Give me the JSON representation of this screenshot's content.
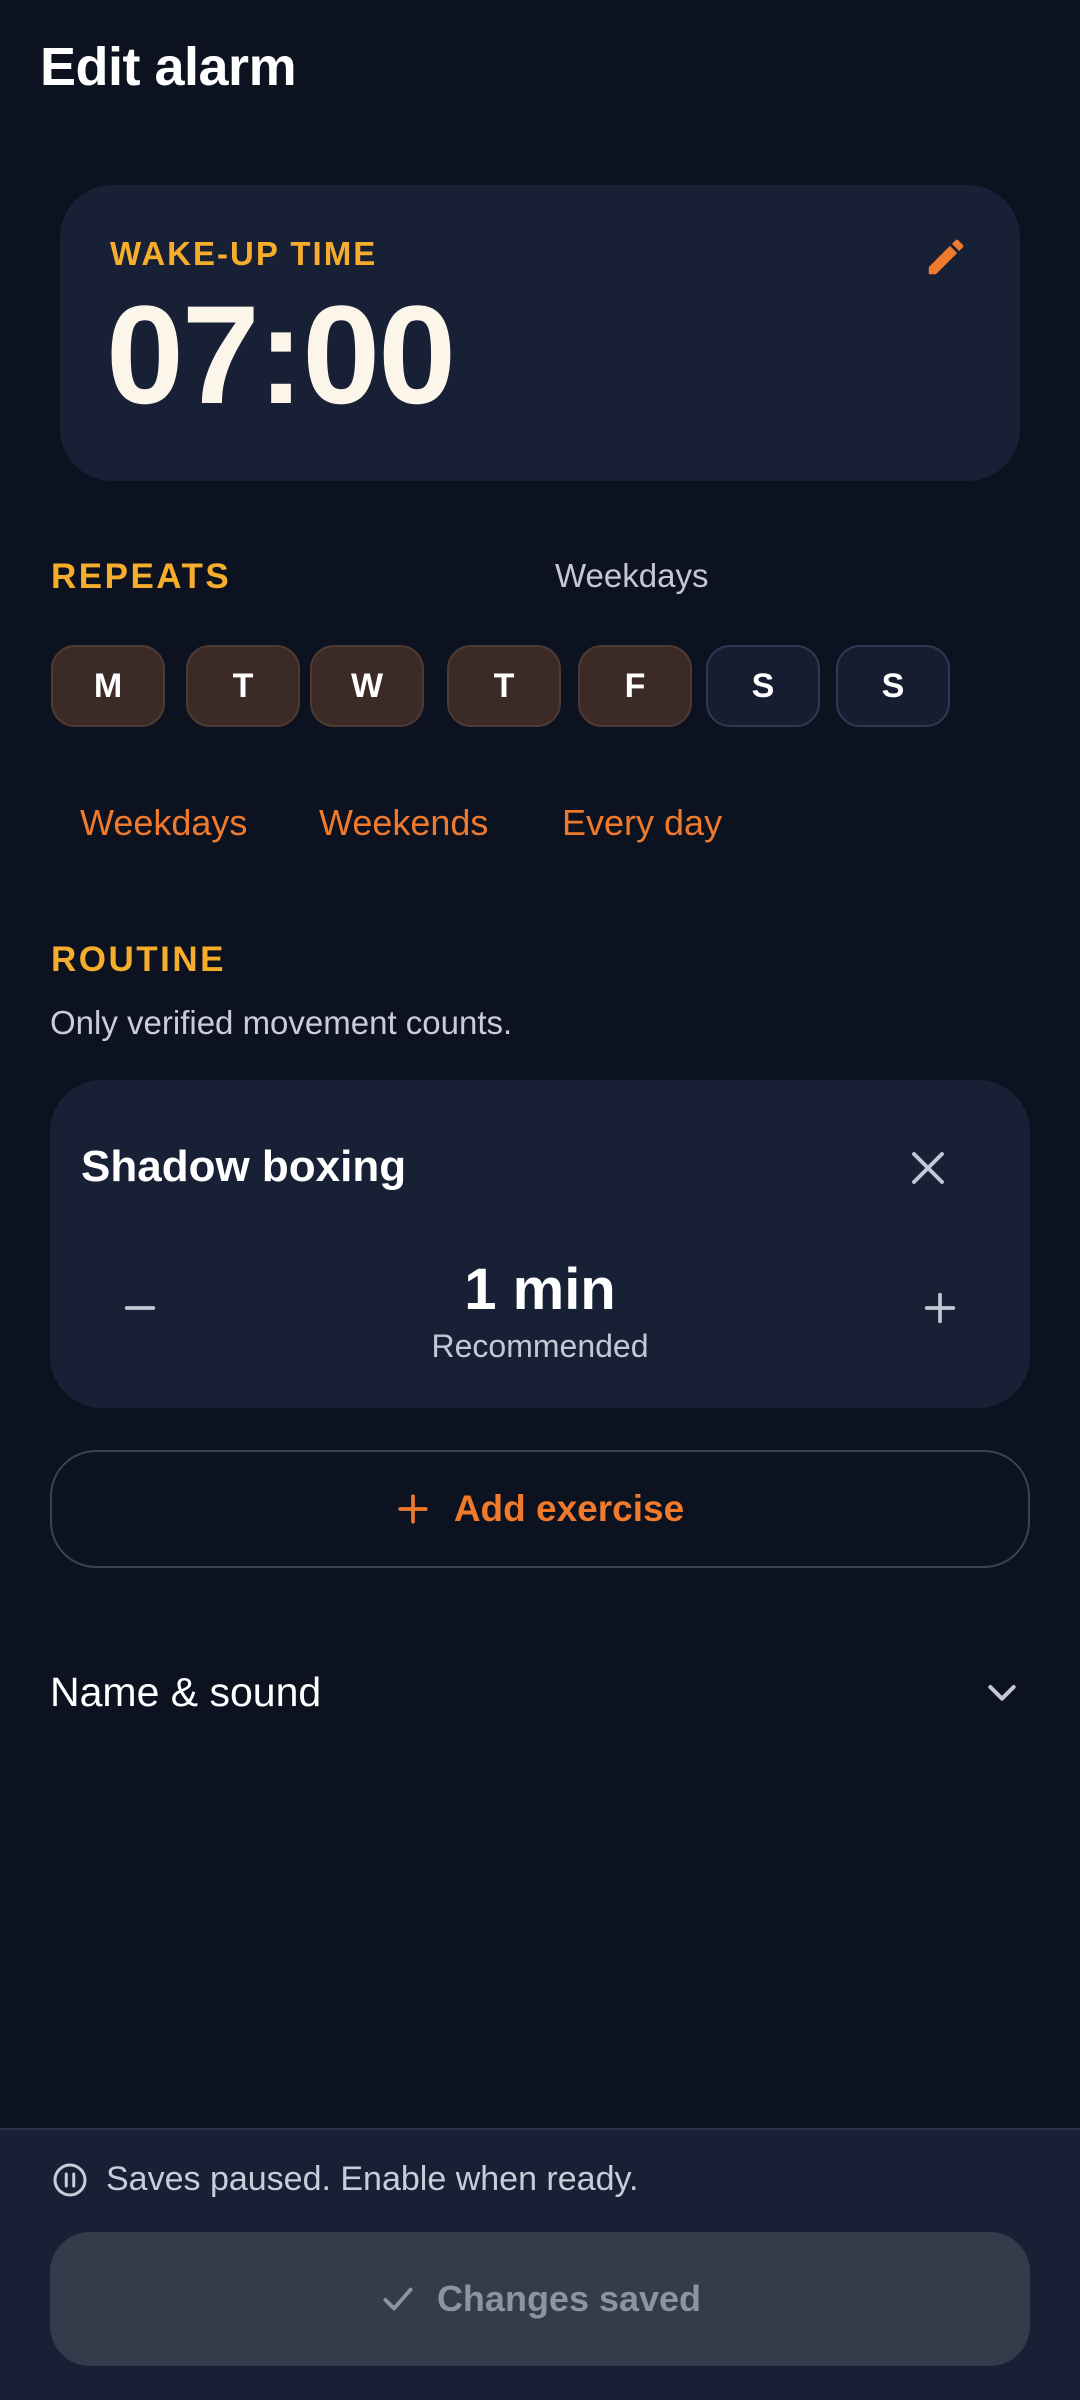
{
  "header": {
    "title": "Edit alarm"
  },
  "wake": {
    "label": "WAKE-UP TIME",
    "time": "07:00",
    "edit_icon": "pencil-icon"
  },
  "repeats": {
    "label": "REPEATS",
    "summary": "Weekdays",
    "days": [
      {
        "letter": "M",
        "selected": true
      },
      {
        "letter": "T",
        "selected": true
      },
      {
        "letter": "W",
        "selected": true
      },
      {
        "letter": "T",
        "selected": true
      },
      {
        "letter": "F",
        "selected": true
      },
      {
        "letter": "S",
        "selected": false
      },
      {
        "letter": "S",
        "selected": false
      }
    ],
    "presets": [
      "Weekdays",
      "Weekends",
      "Every day"
    ]
  },
  "routine": {
    "label": "ROUTINE",
    "subtitle": "Only verified movement counts.",
    "exercise": {
      "name": "Shadow boxing",
      "duration": "1 min",
      "note": "Recommended",
      "remove_icon": "close-icon",
      "decrease_icon": "minus-icon",
      "increase_icon": "plus-icon"
    },
    "add_label": "Add exercise"
  },
  "name_sound": {
    "label": "Name & sound",
    "icon": "chevron-down-icon"
  },
  "footer": {
    "status": "Saves paused. Enable when ready.",
    "status_icon": "pause-circle-icon",
    "save_label": "Changes saved",
    "save_icon": "check-icon"
  },
  "colors": {
    "background": "#0d1220",
    "card": "#182036",
    "accent_orange": "#f07a2c",
    "accent_amber": "#f5ad2b",
    "chip_selected": "#3b2a25",
    "chip_unselected": "#161d30"
  }
}
